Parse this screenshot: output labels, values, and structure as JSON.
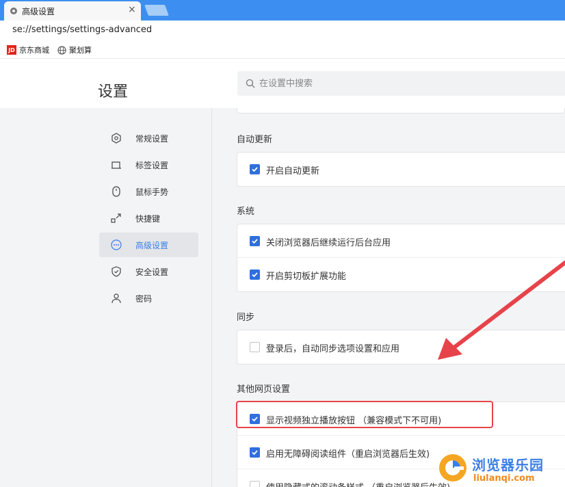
{
  "tab": {
    "title": "高级设置",
    "close": "×"
  },
  "address": {
    "url": "se://settings/settings-advanced"
  },
  "bookmarks": [
    {
      "label": "京东商城",
      "icon": "jd-icon",
      "icon_text": "JD"
    },
    {
      "label": "聚划算",
      "icon": "globe-icon"
    }
  ],
  "header": {
    "title": "设置",
    "search_placeholder": "在设置中搜索"
  },
  "sidebar": {
    "items": [
      {
        "label": "常规设置",
        "icon": "hexagon-gear-icon"
      },
      {
        "label": "标签设置",
        "icon": "tab-icon"
      },
      {
        "label": "鼠标手势",
        "icon": "mouse-icon"
      },
      {
        "label": "快捷键",
        "icon": "shortcut-arrow-icon"
      },
      {
        "label": "高级设置",
        "icon": "more-dots-icon",
        "active": true
      },
      {
        "label": "安全设置",
        "icon": "shield-icon"
      },
      {
        "label": "密码",
        "icon": "user-icon"
      }
    ]
  },
  "sections": {
    "auto_update": {
      "title": "自动更新",
      "options": [
        {
          "label": "开启自动更新",
          "checked": true
        }
      ]
    },
    "system": {
      "title": "系统",
      "options": [
        {
          "label": "关闭浏览器后继续运行后台应用",
          "checked": true
        },
        {
          "label": "开启剪切板扩展功能",
          "checked": true
        }
      ]
    },
    "sync": {
      "title": "同步",
      "options": [
        {
          "label": "登录后，自动同步选项设置和应用",
          "checked": false
        }
      ]
    },
    "other_web": {
      "title": "其他网页设置",
      "options": [
        {
          "label": "显示视频独立播放按钮 （兼容模式下不可用)",
          "checked": true
        },
        {
          "label": "启用无障碍阅读组件（重启浏览器后生效)",
          "checked": true
        },
        {
          "label": "使用隐藏式的滚动条样式 （重启浏览器后生效)",
          "checked": false
        }
      ]
    }
  },
  "colors": {
    "accent": "#3c7ee8",
    "checkbox": "#2f6fde",
    "highlight": "#e7434a",
    "tabbar": "#3c8ff0"
  },
  "watermark": {
    "cn": "浏览器乐园",
    "en": "liulanqi.com"
  }
}
